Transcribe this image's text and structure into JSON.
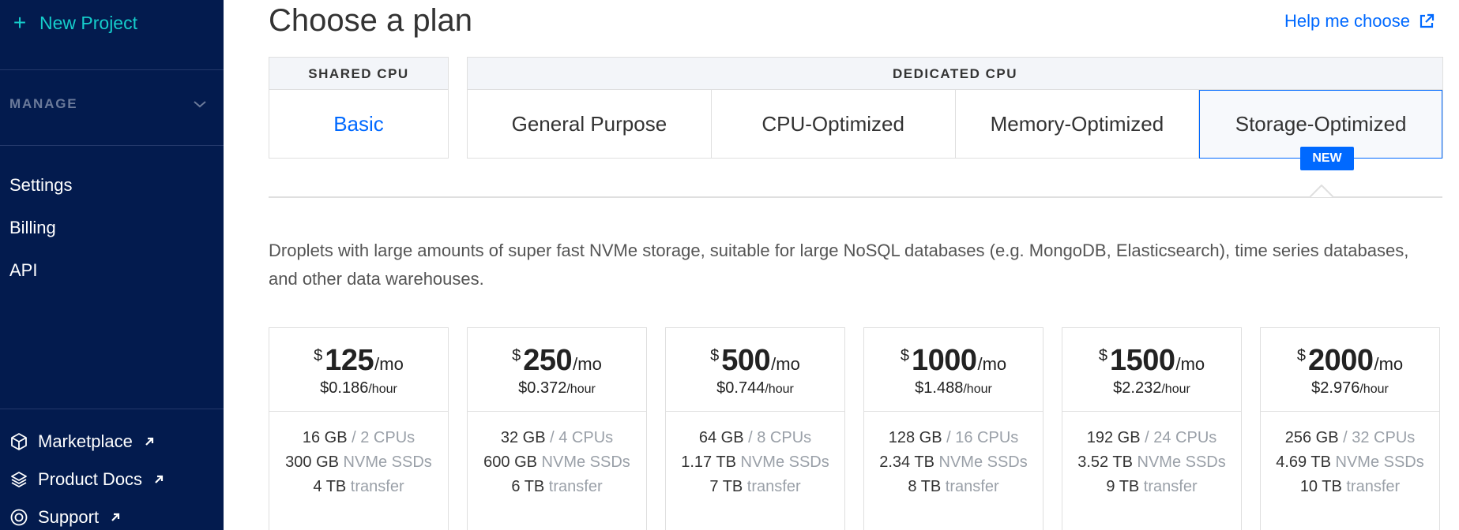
{
  "sidebar": {
    "new_project": "New Project",
    "manage_label": "MANAGE",
    "nav": [
      "Settings",
      "Billing",
      "API"
    ],
    "external": [
      {
        "label": "Marketplace",
        "icon": "cube-icon"
      },
      {
        "label": "Product Docs",
        "icon": "layers-icon"
      },
      {
        "label": "Support",
        "icon": "lifebuoy-icon"
      }
    ]
  },
  "header": {
    "title": "Choose a plan",
    "help": "Help me choose"
  },
  "plan_groups": {
    "shared": {
      "heading": "SHARED CPU",
      "tabs": [
        "Basic"
      ]
    },
    "dedicated": {
      "heading": "DEDICATED CPU",
      "tabs": [
        "General Purpose",
        "CPU-Optimized",
        "Memory-Optimized",
        "Storage-Optimized"
      ]
    },
    "active_tab": "Storage-Optimized",
    "badge": "NEW"
  },
  "description": "Droplets with large amounts of super fast NVMe storage, suitable for large NoSQL databases (e.g. MongoDB, Elasticsearch), time series databases, and other data warehouses.",
  "cards": [
    {
      "currency": "$",
      "amount": "125",
      "per_month": "/mo",
      "hourly": "$0.186",
      "per_hour": "/hour",
      "memory": "16 GB",
      "cpus": " / 2 CPUs",
      "storage": "300 GB",
      "storage_type": " NVMe SSDs",
      "transfer": "4 TB",
      "transfer_label": " transfer"
    },
    {
      "currency": "$",
      "amount": "250",
      "per_month": "/mo",
      "hourly": "$0.372",
      "per_hour": "/hour",
      "memory": "32 GB",
      "cpus": " / 4 CPUs",
      "storage": "600 GB",
      "storage_type": " NVMe SSDs",
      "transfer": "6 TB",
      "transfer_label": " transfer"
    },
    {
      "currency": "$",
      "amount": "500",
      "per_month": "/mo",
      "hourly": "$0.744",
      "per_hour": "/hour",
      "memory": "64 GB",
      "cpus": " / 8 CPUs",
      "storage": "1.17 TB",
      "storage_type": " NVMe SSDs",
      "transfer": "7 TB",
      "transfer_label": " transfer"
    },
    {
      "currency": "$",
      "amount": "1000",
      "per_month": "/mo",
      "hourly": "$1.488",
      "per_hour": "/hour",
      "memory": "128 GB",
      "cpus": " / 16 CPUs",
      "storage": "2.34 TB",
      "storage_type": " NVMe SSDs",
      "transfer": "8 TB",
      "transfer_label": " transfer"
    },
    {
      "currency": "$",
      "amount": "1500",
      "per_month": "/mo",
      "hourly": "$2.232",
      "per_hour": "/hour",
      "memory": "192 GB",
      "cpus": " / 24 CPUs",
      "storage": "3.52 TB",
      "storage_type": " NVMe SSDs",
      "transfer": "9 TB",
      "transfer_label": " transfer"
    },
    {
      "currency": "$",
      "amount": "2000",
      "per_month": "/mo",
      "hourly": "$2.976",
      "per_hour": "/hour",
      "memory": "256 GB",
      "cpus": " / 32 CPUs",
      "storage": "4.69 TB",
      "storage_type": " NVMe SSDs",
      "transfer": "10 TB",
      "transfer_label": " transfer"
    }
  ],
  "colors": {
    "sidebar_bg": "#031b4e",
    "accent": "#0069ff",
    "new_project": "#15cdcb"
  }
}
